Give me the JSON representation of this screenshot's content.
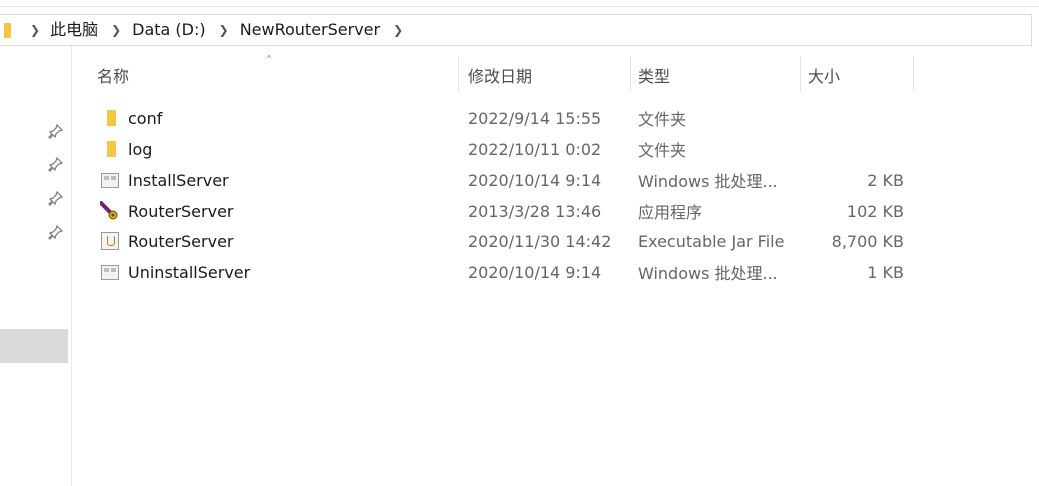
{
  "breadcrumb": {
    "items": [
      "此电脑",
      "Data (D:)",
      "NewRouterServer"
    ]
  },
  "columns": {
    "name": "名称",
    "date": "修改日期",
    "type": "类型",
    "size": "大小"
  },
  "files": [
    {
      "name": "conf",
      "date": "2022/9/14 15:55",
      "type": "文件夹",
      "size": "",
      "icon": "folder-icon"
    },
    {
      "name": "log",
      "date": "2022/10/11 0:02",
      "type": "文件夹",
      "size": "",
      "icon": "folder-icon"
    },
    {
      "name": "InstallServer",
      "date": "2020/10/14 9:14",
      "type": "Windows 批处理...",
      "size": "2 KB",
      "icon": "batch-file-icon"
    },
    {
      "name": "RouterServer",
      "date": "2013/3/28 13:46",
      "type": "应用程序",
      "size": "102 KB",
      "icon": "application-icon"
    },
    {
      "name": "RouterServer",
      "date": "2020/11/30 14:42",
      "type": "Executable Jar File",
      "size": "8,700 KB",
      "icon": "jar-file-icon"
    },
    {
      "name": "UninstallServer",
      "date": "2020/10/14 9:14",
      "type": "Windows 批处理...",
      "size": "1 KB",
      "icon": "batch-file-icon"
    }
  ],
  "colors": {
    "folder": "#f5c644",
    "selection": "#d9d9d9"
  }
}
